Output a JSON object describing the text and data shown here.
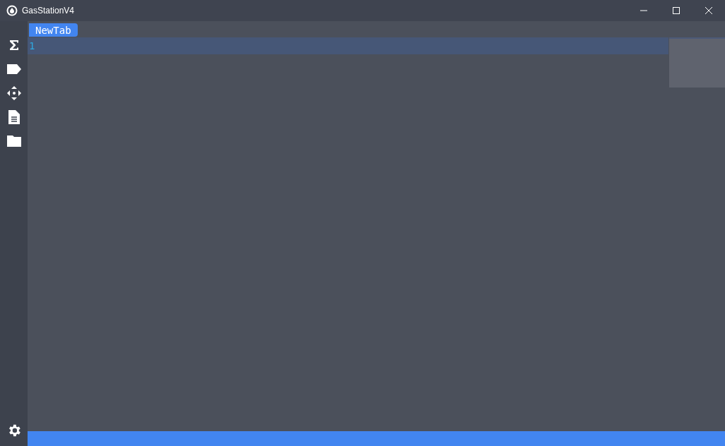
{
  "window": {
    "title": "GasStationV4"
  },
  "tabs": [
    {
      "label": "NewTab",
      "selected": true
    }
  ],
  "editor": {
    "lines": [
      {
        "number": "1",
        "current": true
      }
    ]
  }
}
